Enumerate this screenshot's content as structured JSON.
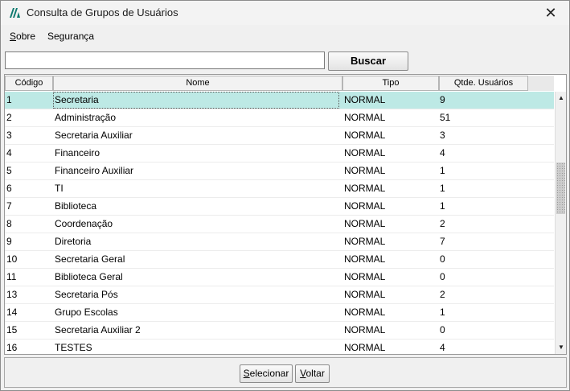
{
  "window": {
    "title": "Consulta de Grupos de Usuários",
    "close_glyph": "✕",
    "icon": "app-logo-icon"
  },
  "menu": {
    "items": [
      {
        "label_u": "S",
        "label_rest": "obre"
      },
      {
        "label_u": "",
        "label_rest": "Segurança"
      }
    ]
  },
  "search": {
    "value": "",
    "placeholder": "",
    "button_label": "Buscar"
  },
  "grid": {
    "columns": [
      "Código",
      "Nome",
      "Tipo",
      "Qtde. Usuários"
    ],
    "rows": [
      {
        "codigo": "1",
        "nome": "Secretaria",
        "tipo": "NORMAL",
        "qtde": "9"
      },
      {
        "codigo": "2",
        "nome": "Administração",
        "tipo": "NORMAL",
        "qtde": "51"
      },
      {
        "codigo": "3",
        "nome": "Secretaria Auxiliar",
        "tipo": "NORMAL",
        "qtde": "3"
      },
      {
        "codigo": "4",
        "nome": "Financeiro",
        "tipo": "NORMAL",
        "qtde": "4"
      },
      {
        "codigo": "5",
        "nome": "Financeiro Auxiliar",
        "tipo": "NORMAL",
        "qtde": "1"
      },
      {
        "codigo": "6",
        "nome": "TI",
        "tipo": "NORMAL",
        "qtde": "1"
      },
      {
        "codigo": "7",
        "nome": "Biblioteca",
        "tipo": "NORMAL",
        "qtde": "1"
      },
      {
        "codigo": "8",
        "nome": "Coordenação",
        "tipo": "NORMAL",
        "qtde": "2"
      },
      {
        "codigo": "9",
        "nome": "Diretoria",
        "tipo": "NORMAL",
        "qtde": "7"
      },
      {
        "codigo": "10",
        "nome": "Secretaria Geral",
        "tipo": "NORMAL",
        "qtde": "0"
      },
      {
        "codigo": "11",
        "nome": "Biblioteca Geral",
        "tipo": "NORMAL",
        "qtde": "0"
      },
      {
        "codigo": "13",
        "nome": "Secretaria Pós",
        "tipo": "NORMAL",
        "qtde": "2"
      },
      {
        "codigo": "14",
        "nome": "Grupo Escolas",
        "tipo": "NORMAL",
        "qtde": "1"
      },
      {
        "codigo": "15",
        "nome": "Secretaria Auxiliar 2",
        "tipo": "NORMAL",
        "qtde": "0"
      },
      {
        "codigo": "16",
        "nome": "TESTES",
        "tipo": "NORMAL",
        "qtde": "4"
      }
    ],
    "selected_row": 0,
    "selection_color": "#bde9e5"
  },
  "footer": {
    "selecionar": {
      "u": "S",
      "rest": "elecionar"
    },
    "voltar": {
      "u": "V",
      "rest": "oltar"
    }
  },
  "scrollbar": {
    "up": "▲",
    "down": "▼"
  }
}
